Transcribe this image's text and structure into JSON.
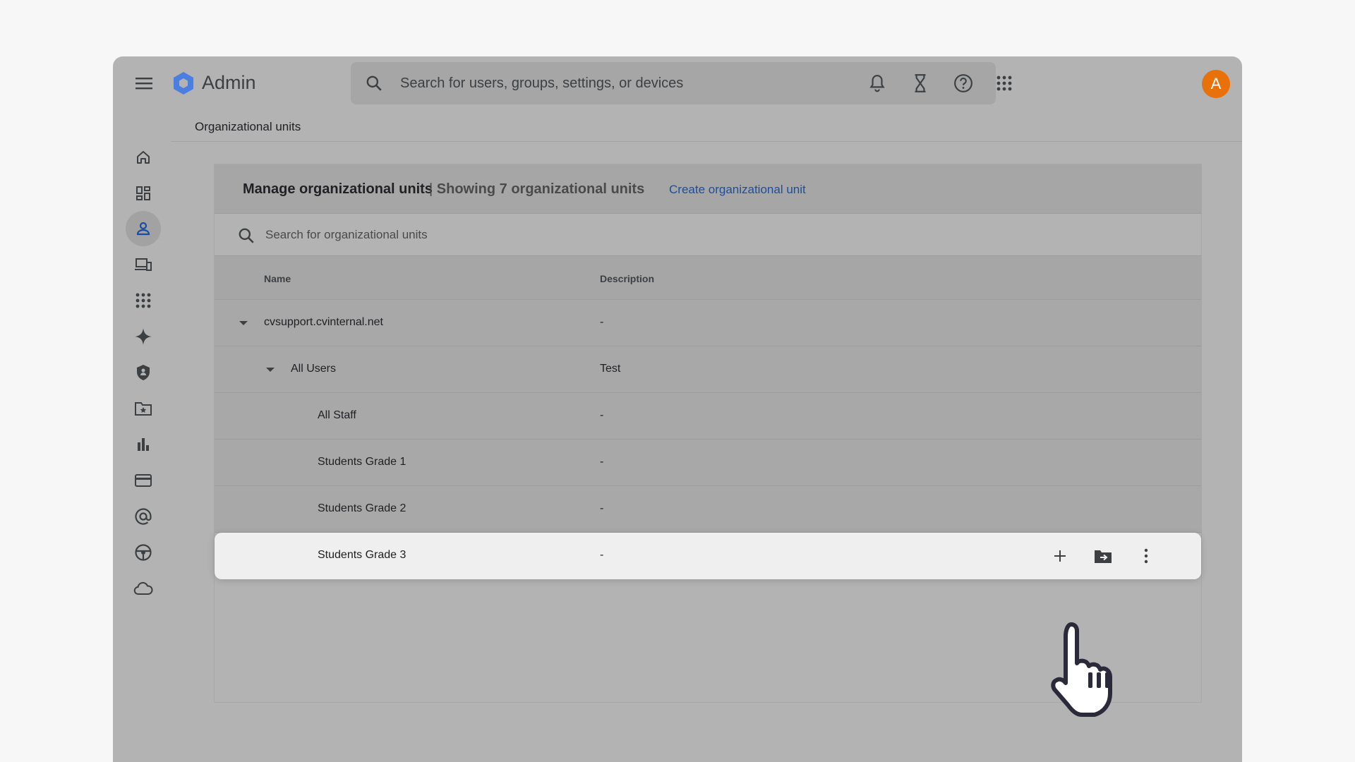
{
  "app": {
    "title": "Admin"
  },
  "search": {
    "placeholder": "Search for users, groups, settings, or devices"
  },
  "avatar": {
    "initial": "A",
    "color": "#e8710a"
  },
  "breadcrumb": "Organizational units",
  "sidebar": {
    "items": [
      {
        "icon": "home-icon"
      },
      {
        "icon": "dashboard-icon"
      },
      {
        "icon": "person-icon",
        "active": true
      },
      {
        "icon": "devices-icon"
      },
      {
        "icon": "apps-grid-icon"
      },
      {
        "icon": "sparkle-icon"
      },
      {
        "icon": "security-shield-icon"
      },
      {
        "icon": "folder-star-icon"
      },
      {
        "icon": "reports-chart-icon"
      },
      {
        "icon": "billing-card-icon"
      },
      {
        "icon": "at-sign-icon"
      },
      {
        "icon": "support-wheel-icon"
      },
      {
        "icon": "cloud-icon"
      }
    ]
  },
  "panel": {
    "title": "Manage organizational units",
    "separator": "|",
    "count_text": "Showing 7 organizational units",
    "create_link": "Create organizational unit",
    "search_placeholder": "Search for organizational units",
    "columns": {
      "name": "Name",
      "description": "Description"
    },
    "rows": [
      {
        "name": "cvsupport.cvinternal.net",
        "description": "-",
        "level": 0,
        "expanded": true
      },
      {
        "name": "All Users",
        "description": "Test",
        "level": 1,
        "expanded": true
      },
      {
        "name": "All Staff",
        "description": "-",
        "level": 2
      },
      {
        "name": "Students Grade 1",
        "description": "-",
        "level": 2
      },
      {
        "name": "Students Grade 2",
        "description": "-",
        "level": 2
      },
      {
        "name": "Students Grade 3",
        "description": "-",
        "level": 2,
        "highlighted": true
      }
    ]
  },
  "colors": {
    "accent": "#1a4ea3",
    "logo": "#4a7ee0"
  }
}
